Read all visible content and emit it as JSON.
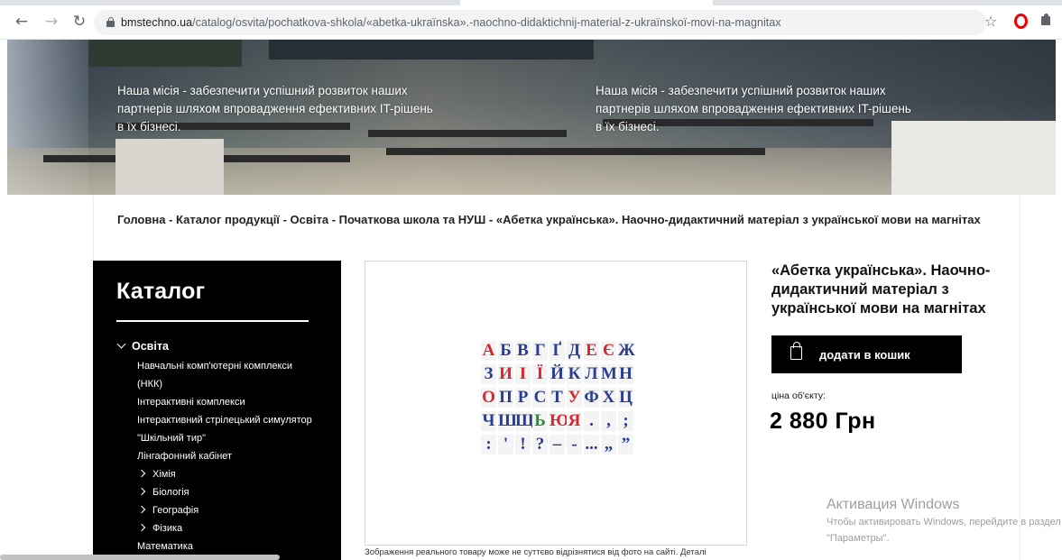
{
  "browser": {
    "url_host": "bmstechno.ua",
    "url_path": "/catalog/osvita/pochatkova-shkola/«abetka-ukraїnska».-naochno-didaktichnij-material-z-ukraїnskoї-movi-na-magnitax"
  },
  "hero": {
    "mission_left": "Наша місія - забезпечити успішний розвиток наших партнерів шляхом впровадження ефективних IT-рішень в їх бізнесі.",
    "mission_right": "Наша місія - забезпечити успішний розвиток наших партнерів шляхом впровадження ефективних IT-рішень в їх бізнесі."
  },
  "breadcrumb": {
    "items": [
      "Головна",
      "Каталог продукції",
      "Освіта",
      "Початкова школа та НУШ",
      "«Абетка українська». Наочно-дидактичний матеріал з української мови на магнітах"
    ],
    "separator": " - "
  },
  "catalog": {
    "title": "Каталог",
    "parent": "Освіта",
    "items": [
      {
        "label": "Навчальні комп'ютерні комплекси (НКК)",
        "sub": false
      },
      {
        "label": "Інтерактивні комплекси",
        "sub": false
      },
      {
        "label": "Інтерактивний стрілецький симулятор \"Шкільний тир\"",
        "sub": false
      },
      {
        "label": "Лінгафонний кабінет",
        "sub": false
      },
      {
        "label": "Хімія",
        "sub": true
      },
      {
        "label": "Біологія",
        "sub": true
      },
      {
        "label": "Географія",
        "sub": true
      },
      {
        "label": "Фізика",
        "sub": true
      },
      {
        "label": "Математика",
        "sub": false
      }
    ]
  },
  "product": {
    "title": "«Абетка українська». Наочно-дидактичний матеріал з української мови на магнітах",
    "cart_button": "додати в кошик",
    "price_label": "ціна об'єкту:",
    "price": "2 880 Грн",
    "image_caption": "Зображення реального товару може не суттєво відрізнятися від фото на сайті. Деталі",
    "letter_rows": [
      [
        {
          "c": "А",
          "col": "#d9262e"
        },
        {
          "c": "Б",
          "col": "#2a3d8f"
        },
        {
          "c": "В",
          "col": "#2a3d8f"
        },
        {
          "c": "Г",
          "col": "#2a3d8f"
        },
        {
          "c": "Ґ",
          "col": "#2a3d8f"
        },
        {
          "c": "Д",
          "col": "#2a3d8f"
        },
        {
          "c": "Е",
          "col": "#d9262e"
        },
        {
          "c": "Є",
          "col": "#d9262e"
        },
        {
          "c": "Ж",
          "col": "#2a3d8f"
        }
      ],
      [
        {
          "c": "З",
          "col": "#2a3d8f"
        },
        {
          "c": "И",
          "col": "#d9262e"
        },
        {
          "c": "І",
          "col": "#d9262e"
        },
        {
          "c": "Ї",
          "col": "#d9262e"
        },
        {
          "c": "Й",
          "col": "#2a3d8f"
        },
        {
          "c": "К",
          "col": "#2a3d8f"
        },
        {
          "c": "Л",
          "col": "#2a3d8f"
        },
        {
          "c": "М",
          "col": "#2a3d8f"
        },
        {
          "c": "Н",
          "col": "#2a3d8f"
        }
      ],
      [
        {
          "c": "О",
          "col": "#d9262e"
        },
        {
          "c": "П",
          "col": "#2a3d8f"
        },
        {
          "c": "Р",
          "col": "#2a3d8f"
        },
        {
          "c": "С",
          "col": "#2a3d8f"
        },
        {
          "c": "Т",
          "col": "#2a3d8f"
        },
        {
          "c": "У",
          "col": "#d9262e"
        },
        {
          "c": "Ф",
          "col": "#2a3d8f"
        },
        {
          "c": "Х",
          "col": "#2a3d8f"
        },
        {
          "c": "Ц",
          "col": "#2a3d8f"
        }
      ],
      [
        {
          "c": "Ч",
          "col": "#2a3d8f"
        },
        {
          "c": "Ш",
          "col": "#2a3d8f"
        },
        {
          "c": "Щ",
          "col": "#2a3d8f"
        },
        {
          "c": "Ь",
          "col": "#2f8a3a"
        },
        {
          "c": "Ю",
          "col": "#d9262e"
        },
        {
          "c": "Я",
          "col": "#d9262e"
        },
        {
          "c": ".",
          "col": "#2a3d8f"
        },
        {
          "c": ",",
          "col": "#2a3d8f"
        },
        {
          "c": ";",
          "col": "#2a3d8f"
        }
      ],
      [
        {
          "c": ":",
          "col": "#2a3d8f"
        },
        {
          "c": "'",
          "col": "#2a3d8f"
        },
        {
          "c": "!",
          "col": "#2a3d8f"
        },
        {
          "c": "?",
          "col": "#2a3d8f"
        },
        {
          "c": "–",
          "col": "#2a3d8f"
        },
        {
          "c": "-",
          "col": "#2a3d8f"
        },
        {
          "c": "...",
          "col": "#2a3d8f"
        },
        {
          "c": "„",
          "col": "#2a3d8f"
        },
        {
          "c": "”",
          "col": "#2a3d8f"
        }
      ]
    ]
  },
  "windows_activation": {
    "title": "Активация Windows",
    "text": "Чтобы активировать Windows, перейдите в раздел \"Параметры\"."
  }
}
